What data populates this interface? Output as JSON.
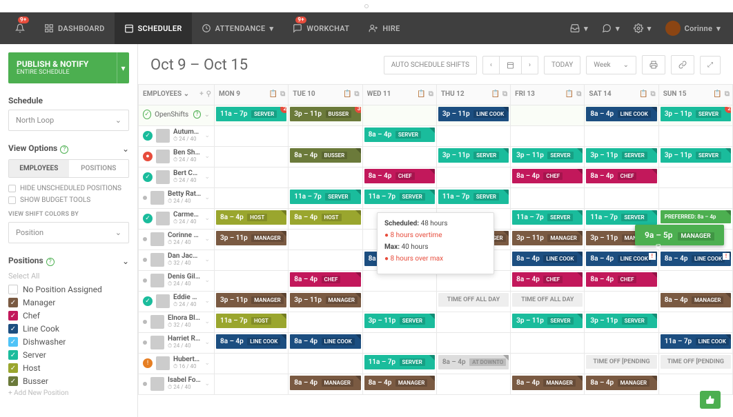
{
  "nav": {
    "dashboard": "DASHBOARD",
    "scheduler": "SCHEDULER",
    "attendance": "ATTENDANCE",
    "workchat": "WORKCHAT",
    "hire": "HIRE",
    "notif_badge": "9+",
    "chat_badge": "9+",
    "user": "Corinne"
  },
  "sidebar": {
    "publish": {
      "title": "PUBLISH & NOTIFY",
      "sub": "ENTIRE SCHEDULE"
    },
    "schedule_label": "Schedule",
    "schedule_value": "North Loop",
    "view_options": "View Options",
    "tab_employees": "EMPLOYEES",
    "tab_positions": "POSITIONS",
    "hide_unscheduled": "HIDE UNSCHEDULED POSITIONS",
    "show_budget": "SHOW BUDGET TOOLS",
    "colors_by_label": "VIEW SHIFT COLORS BY",
    "colors_by_value": "Position",
    "positions_label": "Positions",
    "select_all": "Select All",
    "positions": [
      {
        "label": "No Position Assigned",
        "color": "",
        "checked": false
      },
      {
        "label": "Manager",
        "color": "#7a5a42",
        "checked": true
      },
      {
        "label": "Chef",
        "color": "#c2185b",
        "checked": true
      },
      {
        "label": "Line Cook",
        "color": "#1c4e80",
        "checked": true
      },
      {
        "label": "Dishwasher",
        "color": "#4fc3f7",
        "checked": true
      },
      {
        "label": "Server",
        "color": "#1abc9c",
        "checked": true
      },
      {
        "label": "Host",
        "color": "#9aa62e",
        "checked": true
      },
      {
        "label": "Busser",
        "color": "#6b7a3a",
        "checked": true
      }
    ],
    "add_new": "+ Add New Position"
  },
  "header": {
    "range": "Oct 9 – Oct 15",
    "auto": "AUTO SCHEDULE SHIFTS",
    "today": "TODAY",
    "week": "Week"
  },
  "days": [
    "MON 9",
    "TUE 10",
    "WED 11",
    "THU 12",
    "FRI 13",
    "SAT 14",
    "SUN 15"
  ],
  "emp_col": "EMPLOYEES",
  "open_shifts_label": "OpenShifts",
  "employees": [
    {
      "name": "Autumn Ro...",
      "hrs": "24 / 40",
      "status": "ok"
    },
    {
      "name": "Ben Shield...",
      "hrs": "24 / 40",
      "status": "warn"
    },
    {
      "name": "Bert Castr...",
      "hrs": "24 / 40",
      "status": "ok"
    },
    {
      "name": "Betty Rathmen",
      "hrs": "24 / 40",
      "status": "dot"
    },
    {
      "name": "Carmen Lowe",
      "hrs": "24 / 40",
      "status": "ok"
    },
    {
      "name": "Corinne Garris...",
      "hrs": "24 / 40",
      "status": "dot"
    },
    {
      "name": "Dan Jackson",
      "hrs": "32 / 40",
      "status": "dot"
    },
    {
      "name": "Denis Gillespie",
      "hrs": "24 / 40",
      "status": "dot"
    },
    {
      "name": "Eddie Combs",
      "hrs": "24 / 40",
      "status": "ok"
    },
    {
      "name": "Elnora Blevins",
      "hrs": "32 / 40",
      "status": "dot"
    },
    {
      "name": "Harriet Roberts",
      "hrs": "24 / 40",
      "status": "dot"
    },
    {
      "name": "Hubert Scott",
      "hrs": "16 / 40",
      "status": "alert"
    },
    {
      "name": "Isabel Foster",
      "hrs": "24 / 40",
      "status": "dot"
    }
  ],
  "open_shifts": [
    {
      "day": 0,
      "time": "11a – 7p",
      "pos": "SERVER",
      "color": "#1abc9c",
      "badge": "2"
    },
    {
      "day": 1,
      "time": "3p – 11p",
      "pos": "BUSSER",
      "color": "#6b7a3a",
      "badge": "3"
    },
    {
      "day": 3,
      "time": "3p – 11p",
      "pos": "LINE COOK",
      "color": "#1c4e80"
    },
    {
      "day": 5,
      "time": "8a – 4p",
      "pos": "LINE COOK",
      "color": "#1c4e80"
    },
    {
      "day": 6,
      "time": "3p – 11p",
      "pos": "SERVER",
      "color": "#1abc9c",
      "badge": "2"
    }
  ],
  "shifts": [
    [
      {
        "day": 2,
        "time": "8a – 4p",
        "pos": "SERVER",
        "color": "#1abc9c"
      }
    ],
    [
      {
        "day": 1,
        "time": "8a – 4p",
        "pos": "BUSSER",
        "color": "#6b7a3a"
      },
      {
        "day": 3,
        "time": "3p – 11p",
        "pos": "SERVER",
        "color": "#1abc9c"
      },
      {
        "day": 4,
        "time": "3p – 11p",
        "pos": "SERVER",
        "color": "#1abc9c"
      },
      {
        "day": 5,
        "time": "3p – 11p",
        "pos": "SERVER",
        "color": "#1abc9c"
      },
      {
        "day": 6,
        "time": "3p – 11p",
        "pos": "SERVER",
        "color": "#1abc9c"
      }
    ],
    [
      {
        "day": 2,
        "time": "8a – 4p",
        "pos": "CHEF",
        "color": "#c2185b"
      },
      {
        "day": 4,
        "time": "8a – 4p",
        "pos": "CHEF",
        "color": "#c2185b"
      },
      {
        "day": 5,
        "time": "8a – 4p",
        "pos": "CHEF",
        "color": "#c2185b"
      }
    ],
    [
      {
        "day": 1,
        "time": "11a – 7p",
        "pos": "SERVER",
        "color": "#1abc9c"
      },
      {
        "day": 2,
        "time": "11a – 7p",
        "pos": "SERVER",
        "color": "#1abc9c"
      },
      {
        "day": 3,
        "time": "11a – 7p",
        "pos": "SERVER",
        "color": "#1abc9c"
      }
    ],
    [
      {
        "day": 0,
        "time": "8a – 4p",
        "pos": "HOST",
        "color": "#9aa62e"
      },
      {
        "day": 1,
        "time": "8a – 4p",
        "pos": "HOST",
        "color": "#9aa62e"
      },
      {
        "day": 4,
        "time": "11a – 7p",
        "pos": "SERVER",
        "color": "#1abc9c"
      },
      {
        "day": 5,
        "time": "11a – 7p",
        "pos": "SERVER",
        "color": "#1abc9c"
      },
      {
        "day": 6,
        "time": "PREFERRED: 8a – 4p",
        "pos": "",
        "color": "#4caf50",
        "pref": true
      }
    ],
    [
      {
        "day": 0,
        "time": "3p – 11p",
        "pos": "MANAGER",
        "color": "#7a5a42"
      },
      {
        "day": 3,
        "time": "3p – 11p",
        "pos": "MANAGER",
        "color": "#7a5a42"
      },
      {
        "day": 4,
        "time": "3p – 11p",
        "pos": "MANAGER",
        "color": "#7a5a42"
      },
      {
        "day": 5,
        "time": "3p – 11p",
        "pos": "MANAGER",
        "color": "#7a5a42"
      }
    ],
    [
      {
        "day": 2,
        "time": "8a – 4p",
        "pos": "LINE COOK",
        "color": "#1c4e80",
        "mark": true
      },
      {
        "day": 4,
        "time": "8a – 4p",
        "pos": "LINE COOK",
        "color": "#1c4e80"
      },
      {
        "day": 5,
        "time": "8a – 4p",
        "pos": "LINE COOK",
        "color": "#1c4e80",
        "alert": true
      },
      {
        "day": 6,
        "time": "8a – 4p",
        "pos": "LINE COOK",
        "color": "#1c4e80",
        "alert": true
      }
    ],
    [
      {
        "day": 1,
        "time": "8a – 4p",
        "pos": "CHEF",
        "color": "#c2185b"
      },
      {
        "day": 4,
        "time": "8a – 4p",
        "pos": "CHEF",
        "color": "#c2185b",
        "striped": true
      },
      {
        "day": 5,
        "time": "8a – 4p",
        "pos": "CHEF",
        "color": "#c2185b",
        "striped": true
      }
    ],
    [
      {
        "day": 0,
        "time": "3p – 11p",
        "pos": "MANAGER",
        "color": "#7a5a42"
      },
      {
        "day": 1,
        "time": "3p – 11p",
        "pos": "MANAGER",
        "color": "#7a5a42"
      },
      {
        "day": 3,
        "time": "TIME OFF ALL DAY",
        "timeoff": true
      },
      {
        "day": 4,
        "time": "TIME OFF ALL DAY",
        "timeoff": true
      },
      {
        "day": 6,
        "time": "8a – 4p",
        "pos": "MANAGER",
        "color": "#7a5a42"
      }
    ],
    [
      {
        "day": 0,
        "time": "11a – 7p",
        "pos": "HOST",
        "color": "#9aa62e"
      },
      {
        "day": 2,
        "time": "3p – 11p",
        "pos": "SERVER",
        "color": "#1abc9c"
      },
      {
        "day": 4,
        "time": "3p – 11p",
        "pos": "SERVER",
        "color": "#1abc9c"
      },
      {
        "day": 5,
        "time": "3p – 11p",
        "pos": "SERVER",
        "color": "#1abc9c"
      }
    ],
    [
      {
        "day": 0,
        "time": "8a – 4p",
        "pos": "LINE COOK",
        "color": "#1c4e80"
      },
      {
        "day": 1,
        "time": "8a – 4p",
        "pos": "LINE COOK",
        "color": "#1c4e80"
      },
      {
        "day": 6,
        "time": "11a – 7p",
        "pos": "LINE COOK",
        "color": "#1c4e80"
      }
    ],
    [
      {
        "day": 2,
        "time": "11a – 7p",
        "pos": "SERVER",
        "color": "#1abc9c"
      },
      {
        "day": 3,
        "time": "8a – 4p",
        "pos": "AT DOWNTO",
        "color": "#ddd",
        "gray": true
      },
      {
        "day": 5,
        "time": "TIME OFF [PENDING",
        "timeoff": true
      },
      {
        "day": 6,
        "time": "TIME OFF [PENDING",
        "timeoff": true
      }
    ],
    [
      {
        "day": 1,
        "time": "8a – 4p",
        "pos": "MANAGER",
        "color": "#7a5a42"
      },
      {
        "day": 2,
        "time": "8a – 4p",
        "pos": "MANAGER",
        "color": "#7a5a42"
      },
      {
        "day": 4,
        "time": "8a – 4p",
        "pos": "MANAGER",
        "color": "#7a5a42"
      },
      {
        "day": 5,
        "time": "8a – 4p",
        "pos": "MANAGER",
        "color": "#7a5a42"
      }
    ]
  ],
  "tooltip": {
    "scheduled_label": "Scheduled:",
    "scheduled_value": "48 hours",
    "overtime": "8 hours overtime",
    "max_label": "Max:",
    "max_value": "40 hours",
    "overmax": "8 hours over max"
  },
  "drag": {
    "time": "9a – 5p",
    "pos": "MANAGER"
  }
}
